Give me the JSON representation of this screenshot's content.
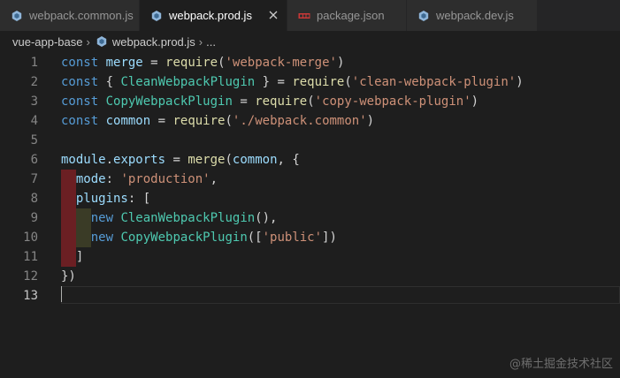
{
  "tabs": [
    {
      "label": "webpack.common.js",
      "active": false,
      "icon": "js-icon"
    },
    {
      "label": "webpack.prod.js",
      "active": true,
      "icon": "js-icon"
    },
    {
      "label": "package.json",
      "active": false,
      "icon": "npm-icon"
    },
    {
      "label": "webpack.dev.js",
      "active": false,
      "icon": "js-icon"
    }
  ],
  "breadcrumb": {
    "folder": "vue-app-base",
    "file": "webpack.prod.js",
    "more": "..."
  },
  "editor": {
    "current_line": 13,
    "lines": [
      {
        "n": "1",
        "tokens": [
          [
            "kw",
            "const"
          ],
          [
            "punc",
            " "
          ],
          [
            "var",
            "merge"
          ],
          [
            "punc",
            " = "
          ],
          [
            "fn",
            "require"
          ],
          [
            "punc",
            "("
          ],
          [
            "str",
            "'webpack-merge'"
          ],
          [
            "punc",
            ")"
          ]
        ]
      },
      {
        "n": "2",
        "tokens": [
          [
            "kw",
            "const"
          ],
          [
            "punc",
            " { "
          ],
          [
            "cls",
            "CleanWebpackPlugin"
          ],
          [
            "punc",
            " } = "
          ],
          [
            "fn",
            "require"
          ],
          [
            "punc",
            "("
          ],
          [
            "str",
            "'clean-webpack-plugin'"
          ],
          [
            "punc",
            ")"
          ]
        ]
      },
      {
        "n": "3",
        "tokens": [
          [
            "kw",
            "const"
          ],
          [
            "punc",
            " "
          ],
          [
            "cls",
            "CopyWebpackPlugin"
          ],
          [
            "punc",
            " = "
          ],
          [
            "fn",
            "require"
          ],
          [
            "punc",
            "("
          ],
          [
            "str",
            "'copy-webpack-plugin'"
          ],
          [
            "punc",
            ")"
          ]
        ]
      },
      {
        "n": "4",
        "tokens": [
          [
            "kw",
            "const"
          ],
          [
            "punc",
            " "
          ],
          [
            "var",
            "common"
          ],
          [
            "punc",
            " = "
          ],
          [
            "fn",
            "require"
          ],
          [
            "punc",
            "("
          ],
          [
            "str",
            "'./webpack.common'"
          ],
          [
            "punc",
            ")"
          ]
        ]
      },
      {
        "n": "5",
        "tokens": []
      },
      {
        "n": "6",
        "tokens": [
          [
            "var",
            "module"
          ],
          [
            "punc",
            "."
          ],
          [
            "var",
            "exports"
          ],
          [
            "punc",
            " = "
          ],
          [
            "fn",
            "merge"
          ],
          [
            "punc",
            "("
          ],
          [
            "var",
            "common"
          ],
          [
            "punc",
            ", {"
          ]
        ]
      },
      {
        "n": "7",
        "indent": 1,
        "tokens": [
          [
            "punc",
            "  "
          ],
          [
            "var",
            "mode"
          ],
          [
            "punc",
            ": "
          ],
          [
            "str",
            "'production'"
          ],
          [
            "punc",
            ","
          ]
        ]
      },
      {
        "n": "8",
        "indent": 1,
        "tokens": [
          [
            "punc",
            "  "
          ],
          [
            "var",
            "plugins"
          ],
          [
            "punc",
            ": ["
          ]
        ]
      },
      {
        "n": "9",
        "indent": 2,
        "tokens": [
          [
            "punc",
            "    "
          ],
          [
            "kw",
            "new"
          ],
          [
            "punc",
            " "
          ],
          [
            "cls",
            "CleanWebpackPlugin"
          ],
          [
            "punc",
            "(),"
          ]
        ]
      },
      {
        "n": "10",
        "indent": 2,
        "tokens": [
          [
            "punc",
            "    "
          ],
          [
            "kw",
            "new"
          ],
          [
            "punc",
            " "
          ],
          [
            "cls",
            "CopyWebpackPlugin"
          ],
          [
            "punc",
            "(["
          ],
          [
            "str",
            "'public'"
          ],
          [
            "punc",
            "])"
          ]
        ]
      },
      {
        "n": "11",
        "indent": 1,
        "tokens": [
          [
            "punc",
            "  ]"
          ]
        ]
      },
      {
        "n": "12",
        "tokens": [
          [
            "punc",
            "})"
          ]
        ]
      },
      {
        "n": "13",
        "tokens": []
      }
    ]
  },
  "watermark": "@稀土掘金技术社区",
  "colors": {
    "keyword": "#569cd6",
    "variable": "#9cdcfe",
    "class": "#4ec9b0",
    "function": "#dcdcaa",
    "string": "#ce9178"
  }
}
